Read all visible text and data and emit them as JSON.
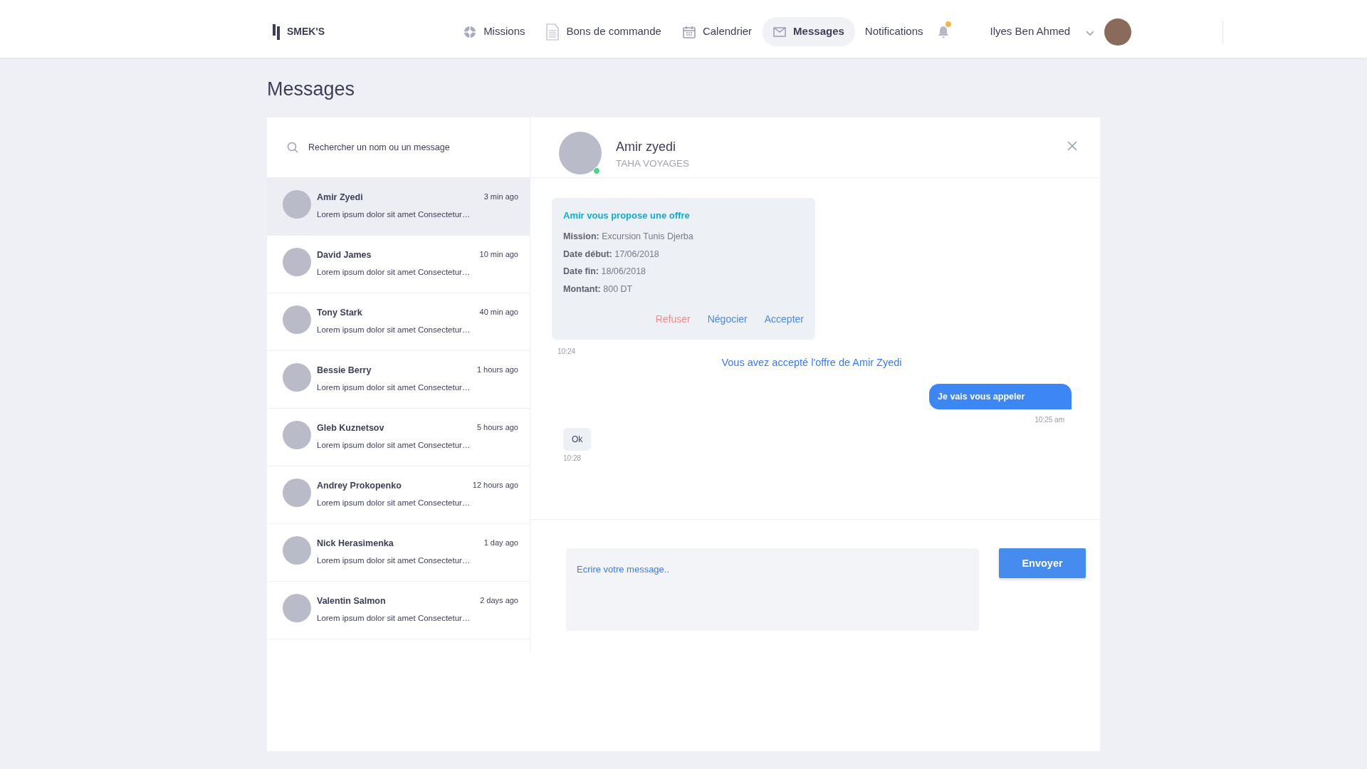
{
  "brand": {
    "name": "SMEK'S"
  },
  "nav": [
    {
      "label": "Missions",
      "selected": false
    },
    {
      "label": "Bons de commande",
      "selected": false
    },
    {
      "label": "Calendrier",
      "selected": false
    },
    {
      "label": "Messages",
      "selected": true
    }
  ],
  "notifications": {
    "label": "Notifications",
    "unread": true
  },
  "user": {
    "name": "Ilyes Ben Ahmed"
  },
  "page_title": "Messages",
  "search": {
    "placeholder": "Rechercher un nom ou un message"
  },
  "conversations": [
    {
      "name": "Amir Zyedi",
      "time": "3 min ago",
      "preview": "Lorem ipsum dolor sit amet Consectetur…",
      "selected": true
    },
    {
      "name": "David James",
      "time": "10 min ago",
      "preview": "Lorem ipsum dolor sit amet Consectetur…",
      "selected": false
    },
    {
      "name": "Tony Stark",
      "time": "40 min ago",
      "preview": "Lorem ipsum dolor sit amet Consectetur…",
      "selected": false
    },
    {
      "name": "Bessie Berry",
      "time": "1 hours ago",
      "preview": "Lorem ipsum dolor sit amet Consectetur…",
      "selected": false
    },
    {
      "name": "Gleb Kuznetsov",
      "time": "5 hours ago",
      "preview": "Lorem ipsum dolor sit amet Consectetur…",
      "selected": false
    },
    {
      "name": "Andrey Prokopenko",
      "time": "12 hours ago",
      "preview": "Lorem ipsum dolor sit amet Consectetur…",
      "selected": false
    },
    {
      "name": "Nick Herasimenka",
      "time": "1 day ago",
      "preview": "Lorem ipsum dolor sit amet Consectetur…",
      "selected": false
    },
    {
      "name": "Valentin Salmon",
      "time": "2 days ago",
      "preview": "Lorem ipsum dolor sit amet Consectetur…",
      "selected": false
    }
  ],
  "chat": {
    "name": "Amir zyedi",
    "company": "TAHA VOYAGES",
    "online": true
  },
  "thread": [
    {
      "kind": "offer",
      "title": "Amir vous propose une offre",
      "fields": [
        {
          "label": "Mission:",
          "value": "Excursion Tunis Djerba"
        },
        {
          "label": "Date début:",
          "value": "17/06/2018"
        },
        {
          "label": "Date fin:",
          "value": "18/06/2018"
        },
        {
          "label": "Montant:",
          "value": "800 DT"
        }
      ],
      "actions": [
        {
          "label": "Refuser",
          "kind": "reject"
        },
        {
          "label": "Négocier",
          "kind": "negotiate"
        },
        {
          "label": "Accepter",
          "kind": "accept"
        }
      ],
      "time": "10:24"
    },
    {
      "kind": "notice",
      "text": "Vous avez accepté l'offre de Amir Zyedi"
    },
    {
      "kind": "outgoing",
      "text": "Je vais vous appeler",
      "time": "10:25 am"
    },
    {
      "kind": "incoming",
      "text": "Ok",
      "time": "10:28"
    }
  ],
  "composer": {
    "placeholder": "Ecrire votre message..",
    "send": "Envoyer"
  }
}
